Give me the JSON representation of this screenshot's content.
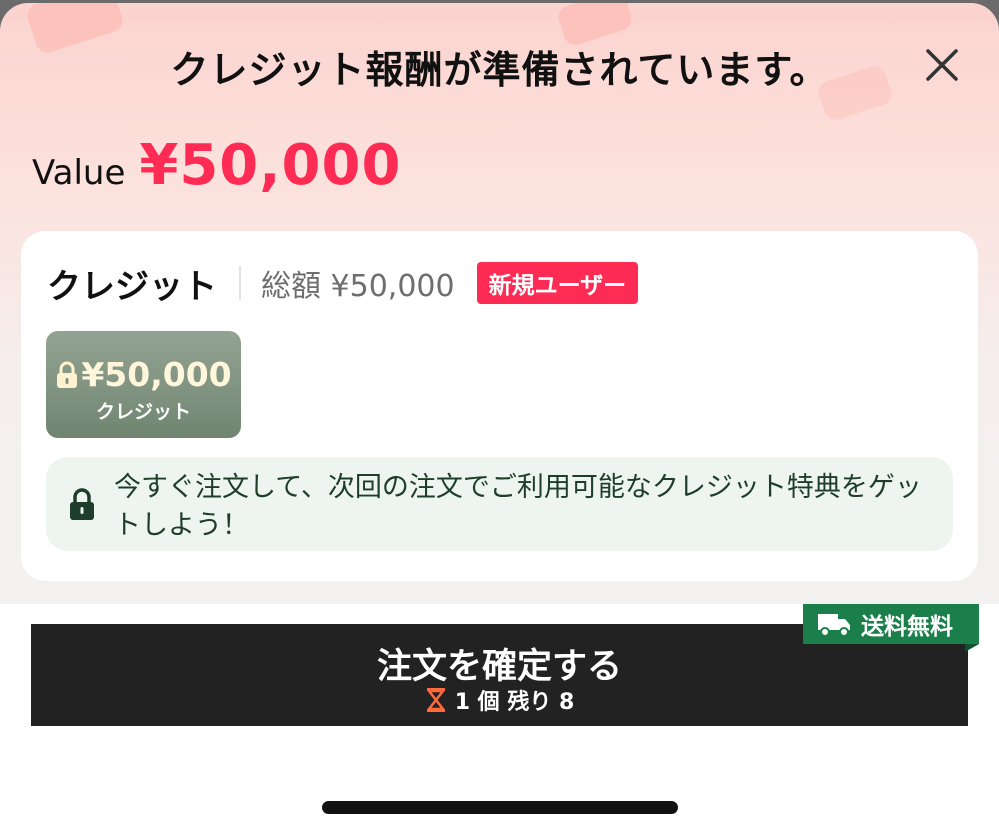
{
  "header": {
    "title": "クレジット報酬が準備されています。",
    "close_icon": "close-icon"
  },
  "value": {
    "label": "Value",
    "amount": "¥50,000"
  },
  "credit_card": {
    "title": "クレジット",
    "total": "総額 ¥50,000",
    "badge": "新規ユーザー",
    "coupon": {
      "amount": "¥50,000",
      "label": "クレジット",
      "icon": "lock-icon"
    },
    "notice": {
      "icon": "lock-icon",
      "text": "今すぐ注文して、次回の注文でご利用可能なクレジット特典をゲットしよう！"
    }
  },
  "purchase": {
    "shipping_tag": "送料無料",
    "shipping_icon": "truck-icon",
    "button_label": "注文を確定する",
    "stock_text": "1 個 残り 8",
    "stock_icon": "hourglass-icon"
  },
  "colors": {
    "accent": "#fe2c55",
    "button": "#222222",
    "shipping": "#1a7f4b",
    "notice_bg": "#eef5f0"
  }
}
